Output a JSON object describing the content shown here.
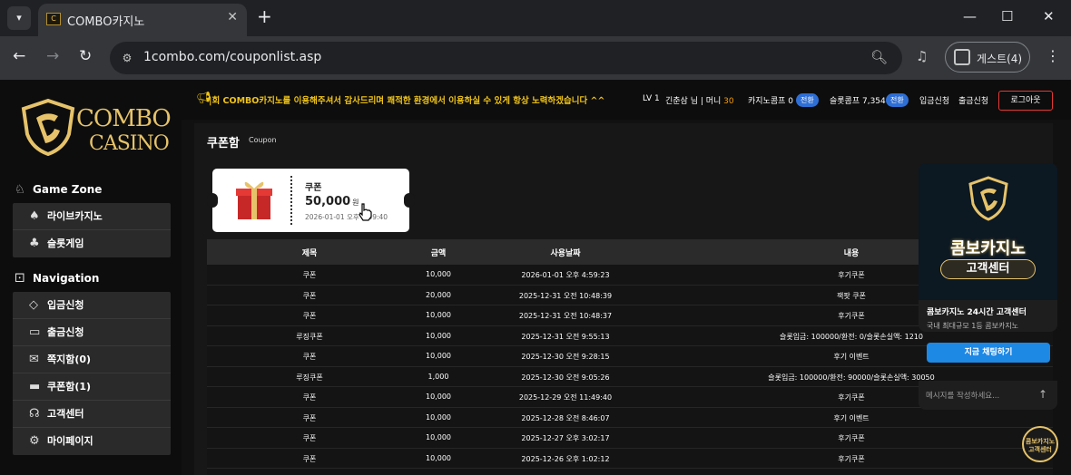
{
  "browser": {
    "tab_title": "COMBO카지노",
    "tab_favicon_text": "C",
    "url": "1combo.com/couponlist.asp",
    "profile_label": "게스트(4)",
    "icons": [
      "chevron-down-icon",
      "close-icon",
      "plus-icon",
      "minimize-icon",
      "maximize-icon",
      "back-icon",
      "forward-icon",
      "reload-icon",
      "site-info-icon",
      "zoom-icon",
      "media-icon",
      "profile-icon",
      "kebab-icon"
    ]
  },
  "logo": {
    "line1": "COMBO",
    "line2": "CASINO"
  },
  "sidebar": {
    "game_zone_title": "Game Zone",
    "game_items": [
      {
        "label": "라이브카지노",
        "icon": "cards-icon"
      },
      {
        "label": "슬롯게임",
        "icon": "slot-icon"
      }
    ],
    "navigation_title": "Navigation",
    "nav_items": [
      {
        "label": "입금신청",
        "icon": "deposit-icon"
      },
      {
        "label": "출금신청",
        "icon": "wallet-icon"
      },
      {
        "label": "쪽지함(0)",
        "icon": "mail-icon"
      },
      {
        "label": "쿠폰함(1)",
        "icon": "coupon-icon"
      },
      {
        "label": "고객센터",
        "icon": "headset-icon"
      },
      {
        "label": "마이페이지",
        "icon": "gear-icon"
      }
    ]
  },
  "header": {
    "marquee": "|회 COMBO카지노를 이용해주셔서 감사드리며 쾌적한 환경에서 이용하실 수 있게 항상 노력하겠습니다 ^^",
    "level": "LV 1",
    "user": "긴춘삼 님 | 머니",
    "money": "30",
    "casino_comp": "카지노콤프 0",
    "casino_convert": "전환",
    "slot_comp": "슬롯콤프 7,354",
    "slot_convert": "전환",
    "deposit": "입금신청",
    "withdraw": "출금신청",
    "logout": "로그아웃"
  },
  "coupon_page": {
    "title": "쿠폰함",
    "subtitle": "Coupon",
    "card": {
      "name": "쿠폰",
      "amount": "50,000",
      "unit": "원",
      "date": "2026-01-01 오후 4:59:40"
    },
    "columns": [
      "제목",
      "금액",
      "사용날짜",
      "내용"
    ],
    "rows": [
      [
        "쿠폰",
        "10,000",
        "2026-01-01 오후 4:59:23",
        "후기쿠폰"
      ],
      [
        "쿠폰",
        "20,000",
        "2025-12-31 오전 10:48:39",
        "잭팟 쿠폰"
      ],
      [
        "쿠폰",
        "10,000",
        "2025-12-31 오전 10:48:37",
        "후기쿠폰"
      ],
      [
        "루징쿠폰",
        "10,000",
        "2025-12-31 오전 9:55:13",
        "슬롯입금: 100000/환전: 0/슬롯손실액: 1210"
      ],
      [
        "쿠폰",
        "10,000",
        "2025-12-30 오전 9:28:15",
        "후기 이벤트"
      ],
      [
        "루징쿠폰",
        "1,000",
        "2025-12-30 오전 9:05:26",
        "슬롯입금: 100000/환전: 90000/슬롯손실액: 30050"
      ],
      [
        "쿠폰",
        "10,000",
        "2025-12-29 오전 11:49:40",
        "후기쿠폰"
      ],
      [
        "쿠폰",
        "10,000",
        "2025-12-28 오전 8:46:07",
        "후기 이벤트"
      ],
      [
        "쿠폰",
        "10,000",
        "2025-12-27 오후 3:02:17",
        "후기쿠폰"
      ],
      [
        "쿠폰",
        "10,000",
        "2025-12-26 오후 1:02:12",
        "후기쿠폰"
      ]
    ]
  },
  "chat": {
    "brand_line1": "콤보카지노",
    "brand_line2": "고객센터",
    "title": "콤보카지노 24시간 고객센터",
    "subtitle": "국내 최대규모 1등 콤보카지노",
    "button": "지금 채팅하기",
    "input_placeholder": "메시지를 작성하세요...",
    "badge_line1": "콤보카지노",
    "badge_line2": "고객센터"
  }
}
